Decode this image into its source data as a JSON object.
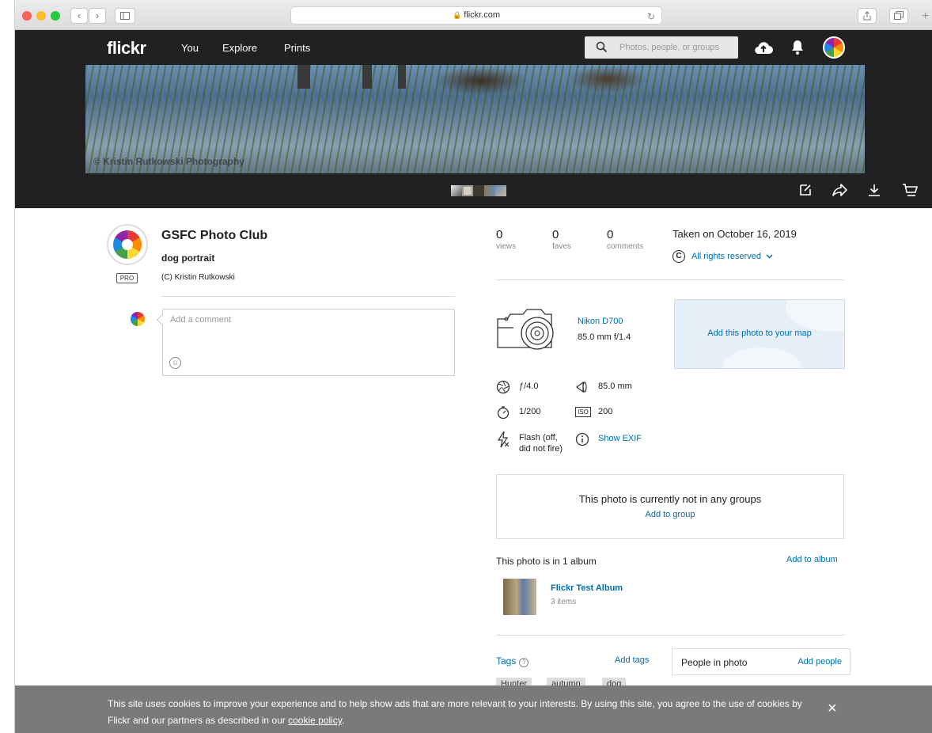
{
  "browser": {
    "url": "flickr.com",
    "lock_icon": "lock-icon"
  },
  "header": {
    "logo": "flickr",
    "nav": [
      "You",
      "Explore",
      "Prints"
    ],
    "search_placeholder": "Photos, people, or groups"
  },
  "photo": {
    "watermark": "© Kristin Rutkowski Photography"
  },
  "owner": {
    "name": "GSFC Photo Club",
    "badge": "PRO",
    "photo_title": "dog portrait",
    "description": "(C) Kristin Rutkowski"
  },
  "comment": {
    "placeholder": "Add a comment"
  },
  "stats": [
    {
      "count": "0",
      "label": "views"
    },
    {
      "count": "0",
      "label": "faves"
    },
    {
      "count": "0",
      "label": "comments"
    }
  ],
  "taken": "Taken on October 16, 2019",
  "license": "All rights reserved",
  "camera": {
    "name": "Nikon D700",
    "lens": "85.0 mm f/1.4"
  },
  "map": {
    "label": "Add this photo to your map"
  },
  "exif": {
    "aperture": "ƒ/4.0",
    "focal": "85.0 mm",
    "shutter": "1/200",
    "iso_label": "ISO",
    "iso": "200",
    "flash_line1": "Flash (off,",
    "flash_line2": "did not fire)",
    "show_exif": "Show EXIF"
  },
  "groups": {
    "message": "This photo is currently not in any groups",
    "add": "Add to group"
  },
  "album": {
    "heading": "This photo is in 1 album",
    "add": "Add to album",
    "name": "Flickr Test Album",
    "count": "3 items"
  },
  "tags": {
    "heading": "Tags",
    "add": "Add tags",
    "items": [
      "Hunter",
      "autumn",
      "dog"
    ]
  },
  "people": {
    "heading": "People in photo",
    "add": "Add people"
  },
  "cookie": {
    "text": "This site uses cookies to improve your experience and to help show ads that are more relevant to your interests. By using this site, you agree to the use of cookies by Flickr and our partners as described in our",
    "link": "cookie policy",
    "end": "."
  },
  "colors": {
    "link": "#006dac",
    "header_bg": "#212124",
    "cookie_bg": "#7a7a7a"
  }
}
